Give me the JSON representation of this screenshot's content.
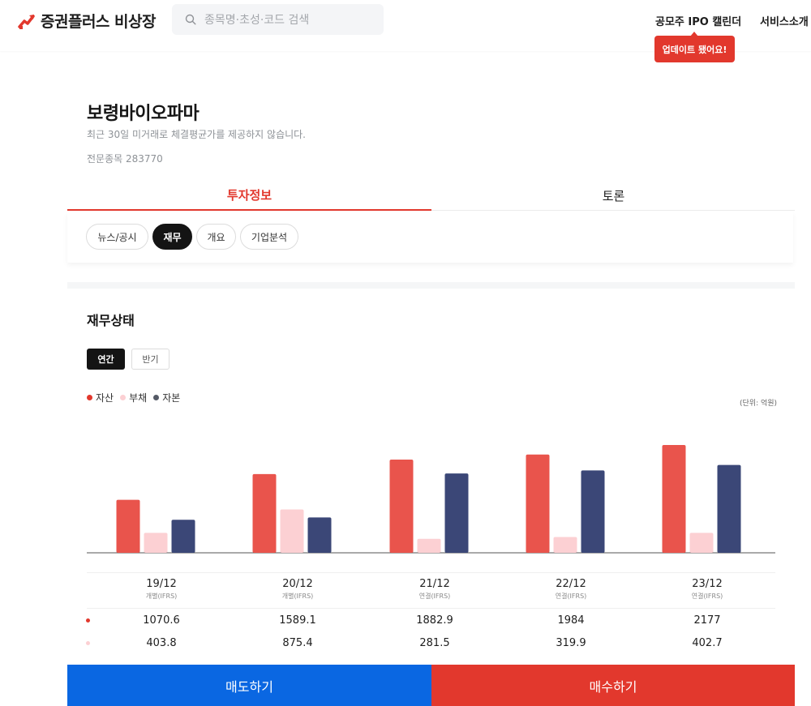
{
  "app": {
    "title": "증권플러스 비상장"
  },
  "search": {
    "placeholder": "종목명·초성·코드 검색"
  },
  "nav": {
    "ipo": "공모주 IPO 캘린더",
    "service": "서비스소개",
    "update_badge": "업데이트 됐어요!"
  },
  "stock": {
    "name": "보령바이오파마",
    "notice": "최근 30일 미거래로 체결평균가를 제공하지 않습니다.",
    "code": "전문종목 283770"
  },
  "tabs": [
    {
      "label": "투자정보",
      "active": true
    },
    {
      "label": "토론",
      "active": false
    }
  ],
  "subtabs": [
    {
      "label": "뉴스/공시",
      "active": false
    },
    {
      "label": "재무",
      "active": true
    },
    {
      "label": "개요",
      "active": false
    },
    {
      "label": "기업분석",
      "active": false
    }
  ],
  "section": {
    "title": "재무상태"
  },
  "period_toggle": {
    "annual": "연간",
    "half": "반기",
    "selected": "연간"
  },
  "legend": [
    {
      "name": "자산",
      "color": "#e9544c"
    },
    {
      "name": "부채",
      "color": "#fcd0d3"
    },
    {
      "name": "자본",
      "color": "#3b4777"
    }
  ],
  "unit": "(단위: 억원)",
  "periods": [
    {
      "label": "19/12",
      "basis": "개별(IFRS)"
    },
    {
      "label": "20/12",
      "basis": "개별(IFRS)"
    },
    {
      "label": "21/12",
      "basis": "연결(IFRS)"
    },
    {
      "label": "22/12",
      "basis": "연결(IFRS)"
    },
    {
      "label": "23/12",
      "basis": "연결(IFRS)"
    }
  ],
  "table": {
    "assets": [
      "1070.6",
      "1589.1",
      "1882.9",
      "1984",
      "2177"
    ],
    "liabilities": [
      "403.8",
      "875.4",
      "281.5",
      "319.9",
      "402.7"
    ]
  },
  "chart_data": {
    "type": "bar",
    "categories": [
      "19/12",
      "20/12",
      "21/12",
      "22/12",
      "23/12"
    ],
    "series": [
      {
        "name": "자산",
        "values": [
          1070.6,
          1589.1,
          1882.9,
          1984,
          2177
        ]
      },
      {
        "name": "부채",
        "values": [
          403.8,
          875.4,
          281.5,
          319.9,
          402.7
        ]
      },
      {
        "name": "자본",
        "values": [
          666.8,
          713.7,
          1601.4,
          1664.1,
          1774.3
        ]
      }
    ],
    "colors": [
      "#e9544c",
      "#fcd0d3",
      "#3b4777"
    ],
    "legend_position": "top-left"
  },
  "actions": {
    "sell": "매도하기",
    "buy": "매수하기"
  }
}
